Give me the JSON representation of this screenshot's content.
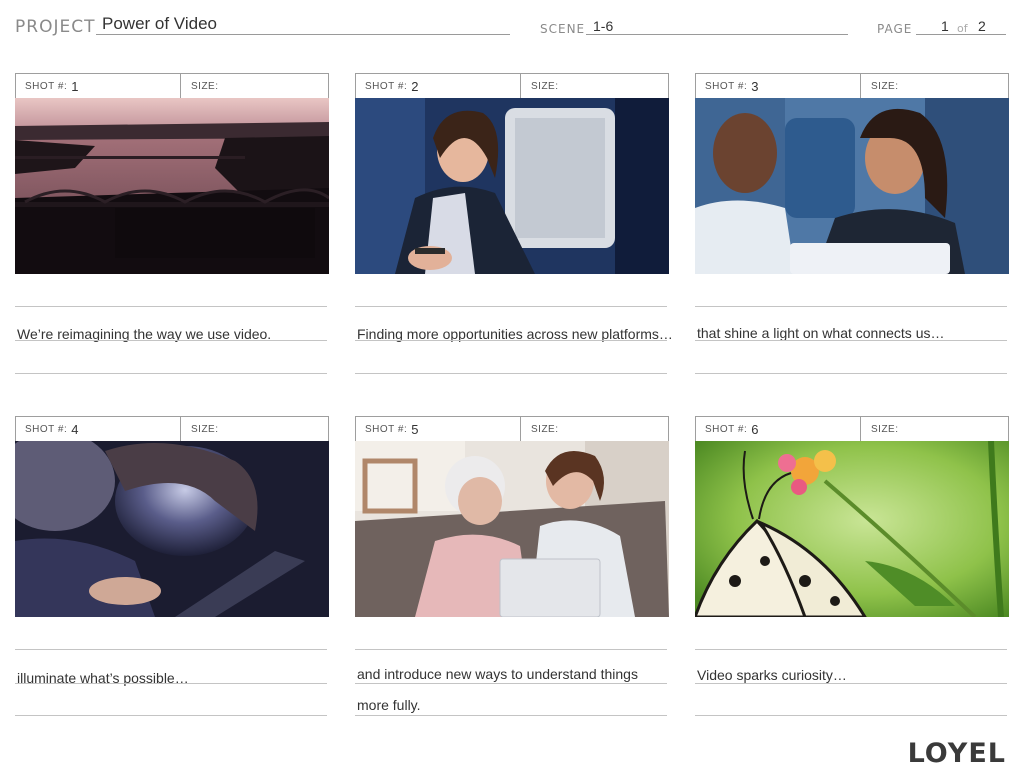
{
  "header": {
    "project_label": "PROJECT",
    "project_value": "Power of Video",
    "scene_label": "SCENE",
    "scene_value": "1-6",
    "page_label": "PAGE",
    "page_value": "1",
    "page_of": "of",
    "page_total": "2"
  },
  "shot_label": "SHOT #:",
  "size_label": "SIZE:",
  "shots": [
    {
      "number": "1",
      "size": "",
      "caption": "We’re reimagining the way we use video.",
      "caption_line2": "",
      "image": "aerial-bridge-sunset"
    },
    {
      "number": "2",
      "size": "",
      "caption": "Finding more opportunities across new platforms…",
      "caption_line2": "",
      "image": "woman-using-phone-on-train"
    },
    {
      "number": "3",
      "size": "",
      "caption": "that shine a light on what connects us…",
      "caption_line2": "",
      "image": "couple-smiling-at-laptop"
    },
    {
      "number": "4",
      "size": "",
      "caption": "illuminate what’s possible…",
      "caption_line2": "",
      "image": "child-lit-by-tablet"
    },
    {
      "number": "5",
      "size": "",
      "caption": "and introduce new ways to understand things",
      "caption_line2": "more fully.",
      "image": "grandmother-and-woman-with-laptop"
    },
    {
      "number": "6",
      "size": "",
      "caption": "Video sparks curiosity…",
      "caption_line2": "",
      "image": "butterfly-on-flower"
    }
  ],
  "logo": "LOYEL"
}
